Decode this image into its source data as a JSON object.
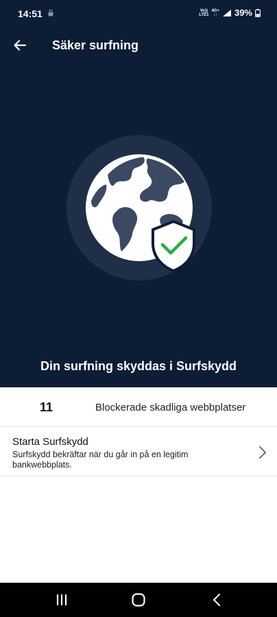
{
  "status_bar": {
    "time": "14:51",
    "net_top": "Vo))",
    "net_mid": "LTE1",
    "net_type": "4G+",
    "battery_percent": "39%",
    "battery_level": 0.39
  },
  "app_bar": {
    "title": "Säker surfning",
    "back_icon": "arrow-left-icon"
  },
  "hero": {
    "background": "#0d1d36",
    "illustration": "globe-with-shield-check",
    "check_color": "#2eaa3f",
    "message": "Din surfning skyddas i Surfskydd"
  },
  "stats": {
    "count": "11",
    "label": "Blockerade skadliga webbplatser"
  },
  "option": {
    "title": "Starta Surfskydd",
    "description": "Surfskydd bekräftar när du går in på en legitim bankwebbplats.",
    "chevron_icon": "chevron-right-icon"
  },
  "nav_bar": {
    "recents_icon": "recents-icon",
    "home_icon": "home-icon",
    "back_icon": "back-chevron-icon"
  }
}
